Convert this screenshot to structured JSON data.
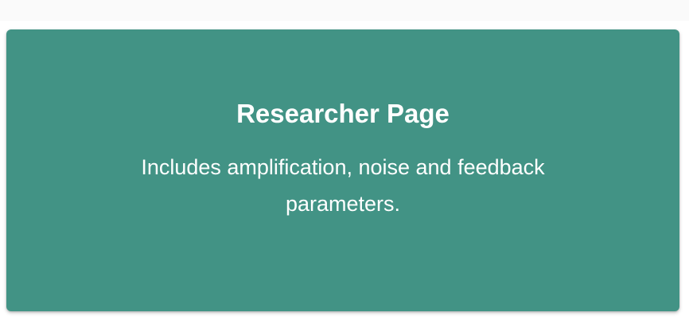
{
  "card": {
    "title": "Researcher Page",
    "description": "Includes amplification, noise and feedback parameters.",
    "background_color": "#429385",
    "text_color": "#ffffff"
  },
  "page": {
    "background_color": "#ffffff",
    "top_strip_color": "#fafafa"
  }
}
